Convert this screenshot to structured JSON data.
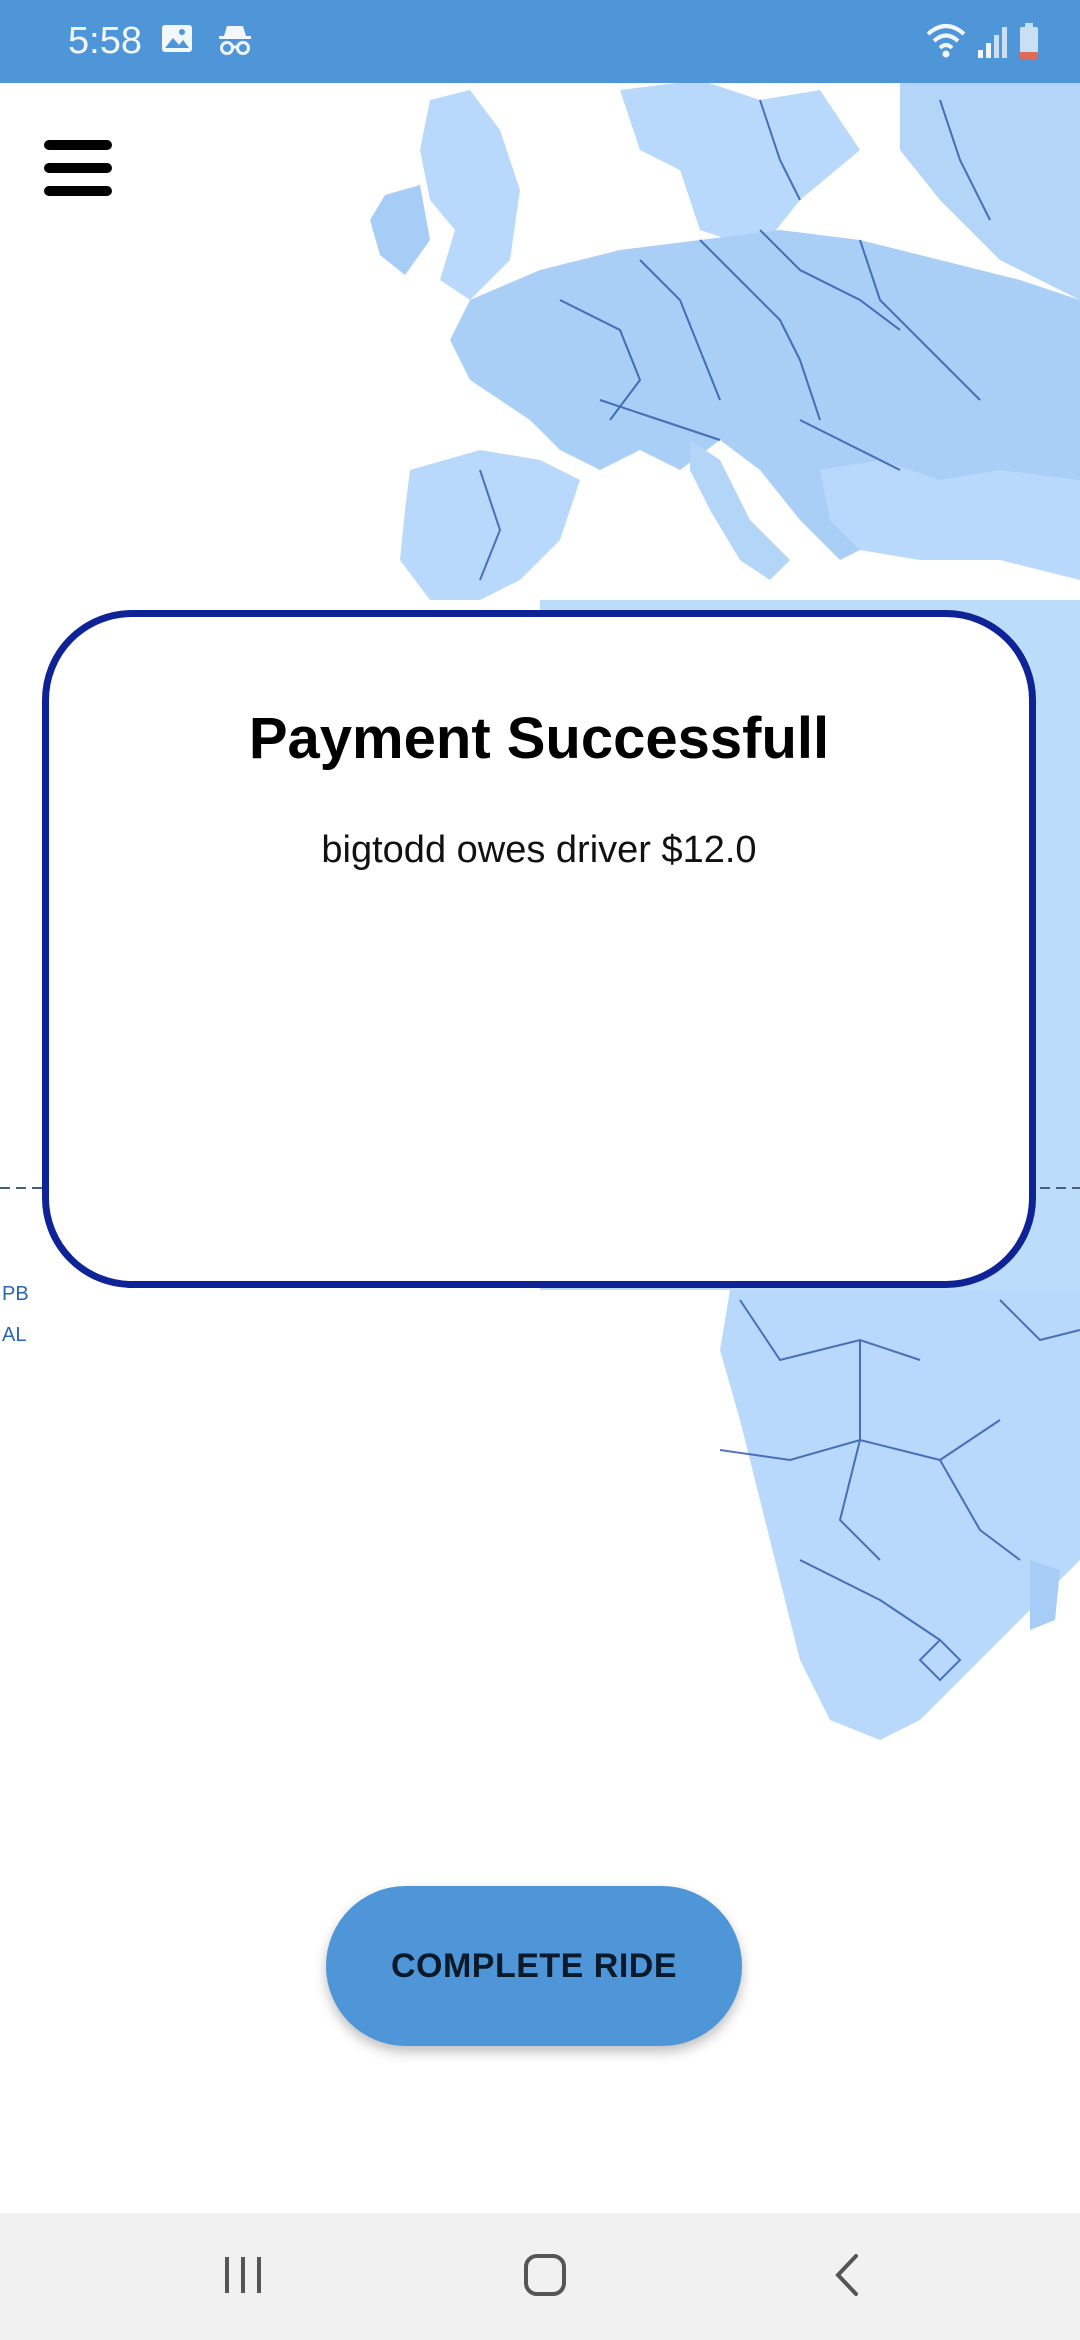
{
  "status_bar": {
    "time": "5:58",
    "left_icons": [
      "image-icon",
      "incognito-icon"
    ],
    "right_icons": [
      "wifi-icon",
      "signal-icon",
      "battery-icon"
    ],
    "background": "#4e96d8"
  },
  "map": {
    "labels": [
      "PB",
      "AL"
    ],
    "land_color": "#b8d9fb",
    "border_color": "#2a55a8"
  },
  "menu": {
    "icon": "hamburger-menu-icon"
  },
  "dialog": {
    "title": "Payment Successfull",
    "message": "bigtodd owes driver $12.0",
    "border_color": "#0d2396"
  },
  "actions": {
    "complete_ride_label": "COMPLETE RIDE",
    "button_color": "#4e96d8"
  },
  "nav_bar": {
    "buttons": [
      "recent-apps-icon",
      "home-icon",
      "back-icon"
    ]
  }
}
